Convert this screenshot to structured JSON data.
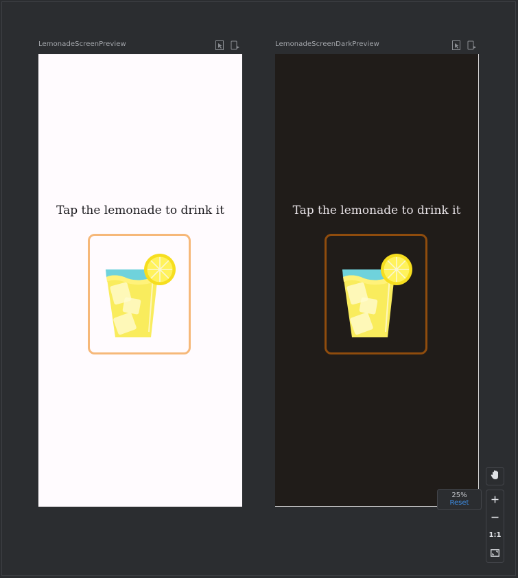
{
  "previews": [
    {
      "title": "LemonadeScreenPreview",
      "theme": "light",
      "instruction": "Tap the lemonade to drink it",
      "background": "#fffbfe",
      "card_border": "#f6b879"
    },
    {
      "title": "LemonadeScreenDarkPreview",
      "theme": "dark",
      "instruction": "Tap the lemonade to drink it",
      "background": "#201c19",
      "card_border": "#8f4c0d"
    }
  ],
  "zoom": {
    "level": "25%",
    "reset_label": "Reset",
    "fit_label": "1:1"
  },
  "icons": {
    "preview_tools": [
      "interactive-mode-icon",
      "deploy-to-device-icon"
    ],
    "pan": "hand-icon",
    "zoom_in": "plus-icon",
    "zoom_out": "minus-icon",
    "fit": "fit-screen-icon"
  },
  "colors": {
    "canvas": "#2b2d30",
    "accent": "#3d8ee6"
  }
}
